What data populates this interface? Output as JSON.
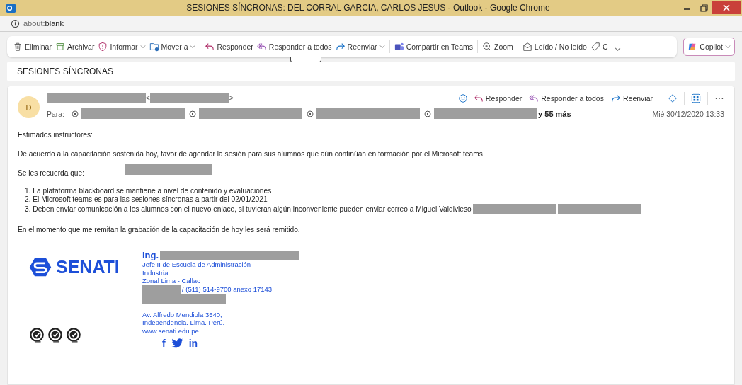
{
  "window": {
    "title": "SESIONES SÍNCRONAS: DEL CORRAL GARCIA, CARLOS JESUS - Outlook - Google Chrome"
  },
  "address_bar": {
    "prefix": "about:",
    "value": "blank"
  },
  "toolbar": {
    "groups": [
      [
        {
          "label": "Eliminar",
          "dropdown": false
        },
        {
          "label": "Archivar",
          "dropdown": false
        },
        {
          "label": "Informar",
          "dropdown": true
        },
        {
          "label": "Mover a",
          "dropdown": true
        }
      ],
      [
        {
          "label": "Responder",
          "dropdown": false
        },
        {
          "label": "Responder a todos",
          "dropdown": false
        },
        {
          "label": "Reenviar",
          "dropdown": true
        }
      ],
      [
        {
          "label": "Compartir en Teams",
          "dropdown": false
        }
      ],
      [
        {
          "label": "Zoom",
          "dropdown": false
        }
      ],
      [
        {
          "label": "Leído / No leído",
          "dropdown": false
        },
        {
          "label": "C",
          "dropdown": false
        }
      ]
    ],
    "copilot": "Copilot"
  },
  "subject": "SESIONES SÍNCRONAS",
  "message": {
    "avatar": "D",
    "sender": {
      "open": "<",
      "close": ">"
    },
    "to_label": "Para:",
    "recipients": [
      {
        "kind": "redacted"
      },
      {
        "kind": "redacted"
      },
      {
        "kind": "redacted"
      },
      {
        "kind": "redacted"
      }
    ],
    "more": "y 55 más",
    "actions": [
      {
        "label": "Responder"
      },
      {
        "label": "Responder a todos"
      },
      {
        "label": "Reenviar"
      }
    ],
    "date": "Mié 30/12/2020 13:33",
    "body": [
      {
        "kind": "paragraph",
        "text": "Estimados instructores:"
      },
      {
        "kind": "paragraph",
        "text": "De acuerdo a la capacitación sostenida hoy, favor de agendar la sesión para sus alumnos que aún continúan en formación por el Microsoft teams"
      },
      {
        "kind": "paragraph",
        "text": "Se les recuerda que:",
        "redactions": [
          {
            "kind": "redacted"
          }
        ]
      },
      {
        "kind": "list",
        "items": [
          {
            "text": "1. La plataforma blackboard se mantiene a nivel de contenido y evaluaciones"
          },
          {
            "text": "2. El Microsoft teams  es para las sesiones síncronas a partir del 02/01/2021"
          },
          {
            "text": "3. Deben enviar comunicación a los alumnos con el nuevo enlace, si tuvieran algún inconveniente pueden enviar correo a Miguel Valdivieso",
            "redactions": [
              {
                "kind": "redacted"
              },
              {
                "kind": "redacted"
              }
            ]
          }
        ]
      },
      {
        "kind": "paragraph",
        "text": "En el momento que me remitan la grabación de la capacitación de hoy les será remitido."
      }
    ],
    "signature": {
      "logo": "SENATI",
      "title": "Ing.",
      "role": [
        "Jefe II de Escuela de Administración",
        "Industrial",
        "Zonal Lima - Callao"
      ],
      "phone": "/ (511) 514-9700 anexo 17143",
      "address": [
        "Av. Alfredo Mendiola 3540,",
        "Independencia. Lima. Perú.",
        "www.senati.edu.pe"
      ],
      "social": [
        "f",
        "in"
      ]
    }
  }
}
